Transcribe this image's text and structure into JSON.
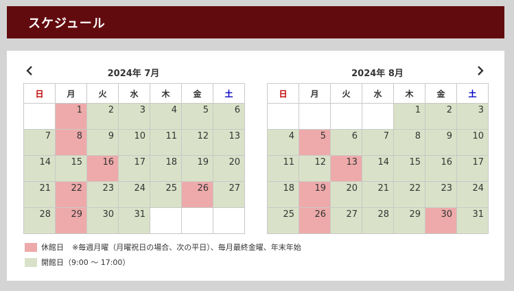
{
  "header": {
    "title": "スケジュール"
  },
  "nav": {
    "prev_icon": "chevron-left-icon",
    "next_icon": "chevron-right-icon"
  },
  "weekdays": [
    "日",
    "月",
    "火",
    "水",
    "木",
    "金",
    "土"
  ],
  "colors": {
    "header_bg": "#620b0e",
    "open": "#d9e2c8",
    "closed": "#eeaaaa",
    "sunday_text": "#c00000",
    "saturday_text": "#0000c8"
  },
  "calendars": [
    {
      "title": "2024年 7月",
      "weeks": [
        [
          null,
          {
            "d": 1,
            "s": "closed"
          },
          {
            "d": 2,
            "s": "open"
          },
          {
            "d": 3,
            "s": "open"
          },
          {
            "d": 4,
            "s": "open"
          },
          {
            "d": 5,
            "s": "open"
          },
          {
            "d": 6,
            "s": "open"
          }
        ],
        [
          {
            "d": 7,
            "s": "open"
          },
          {
            "d": 8,
            "s": "closed"
          },
          {
            "d": 9,
            "s": "open"
          },
          {
            "d": 10,
            "s": "open"
          },
          {
            "d": 11,
            "s": "open"
          },
          {
            "d": 12,
            "s": "open"
          },
          {
            "d": 13,
            "s": "open"
          }
        ],
        [
          {
            "d": 14,
            "s": "open"
          },
          {
            "d": 15,
            "s": "open"
          },
          {
            "d": 16,
            "s": "closed"
          },
          {
            "d": 17,
            "s": "open"
          },
          {
            "d": 18,
            "s": "open"
          },
          {
            "d": 19,
            "s": "open"
          },
          {
            "d": 20,
            "s": "open"
          }
        ],
        [
          {
            "d": 21,
            "s": "open"
          },
          {
            "d": 22,
            "s": "closed"
          },
          {
            "d": 23,
            "s": "open"
          },
          {
            "d": 24,
            "s": "open"
          },
          {
            "d": 25,
            "s": "open"
          },
          {
            "d": 26,
            "s": "closed"
          },
          {
            "d": 27,
            "s": "open"
          }
        ],
        [
          {
            "d": 28,
            "s": "open"
          },
          {
            "d": 29,
            "s": "closed"
          },
          {
            "d": 30,
            "s": "open"
          },
          {
            "d": 31,
            "s": "open"
          },
          null,
          null,
          null
        ]
      ]
    },
    {
      "title": "2024年 8月",
      "weeks": [
        [
          null,
          null,
          null,
          null,
          {
            "d": 1,
            "s": "open"
          },
          {
            "d": 2,
            "s": "open"
          },
          {
            "d": 3,
            "s": "open"
          }
        ],
        [
          {
            "d": 4,
            "s": "open"
          },
          {
            "d": 5,
            "s": "closed"
          },
          {
            "d": 6,
            "s": "open"
          },
          {
            "d": 7,
            "s": "open"
          },
          {
            "d": 8,
            "s": "open"
          },
          {
            "d": 9,
            "s": "open"
          },
          {
            "d": 10,
            "s": "open"
          }
        ],
        [
          {
            "d": 11,
            "s": "open"
          },
          {
            "d": 12,
            "s": "open"
          },
          {
            "d": 13,
            "s": "closed"
          },
          {
            "d": 14,
            "s": "open"
          },
          {
            "d": 15,
            "s": "open"
          },
          {
            "d": 16,
            "s": "open"
          },
          {
            "d": 17,
            "s": "open"
          }
        ],
        [
          {
            "d": 18,
            "s": "open"
          },
          {
            "d": 19,
            "s": "closed"
          },
          {
            "d": 20,
            "s": "open"
          },
          {
            "d": 21,
            "s": "open"
          },
          {
            "d": 22,
            "s": "open"
          },
          {
            "d": 23,
            "s": "open"
          },
          {
            "d": 24,
            "s": "open"
          }
        ],
        [
          {
            "d": 25,
            "s": "open"
          },
          {
            "d": 26,
            "s": "closed"
          },
          {
            "d": 27,
            "s": "open"
          },
          {
            "d": 28,
            "s": "open"
          },
          {
            "d": 29,
            "s": "open"
          },
          {
            "d": 30,
            "s": "closed"
          },
          {
            "d": 31,
            "s": "open"
          }
        ]
      ]
    }
  ],
  "legend": {
    "closed_label": "休館日",
    "closed_note": "※毎週月曜（月曜祝日の場合、次の平日）、毎月最終金曜、年末年始",
    "open_label": "開館日（9:00 ～ 17:00）"
  }
}
